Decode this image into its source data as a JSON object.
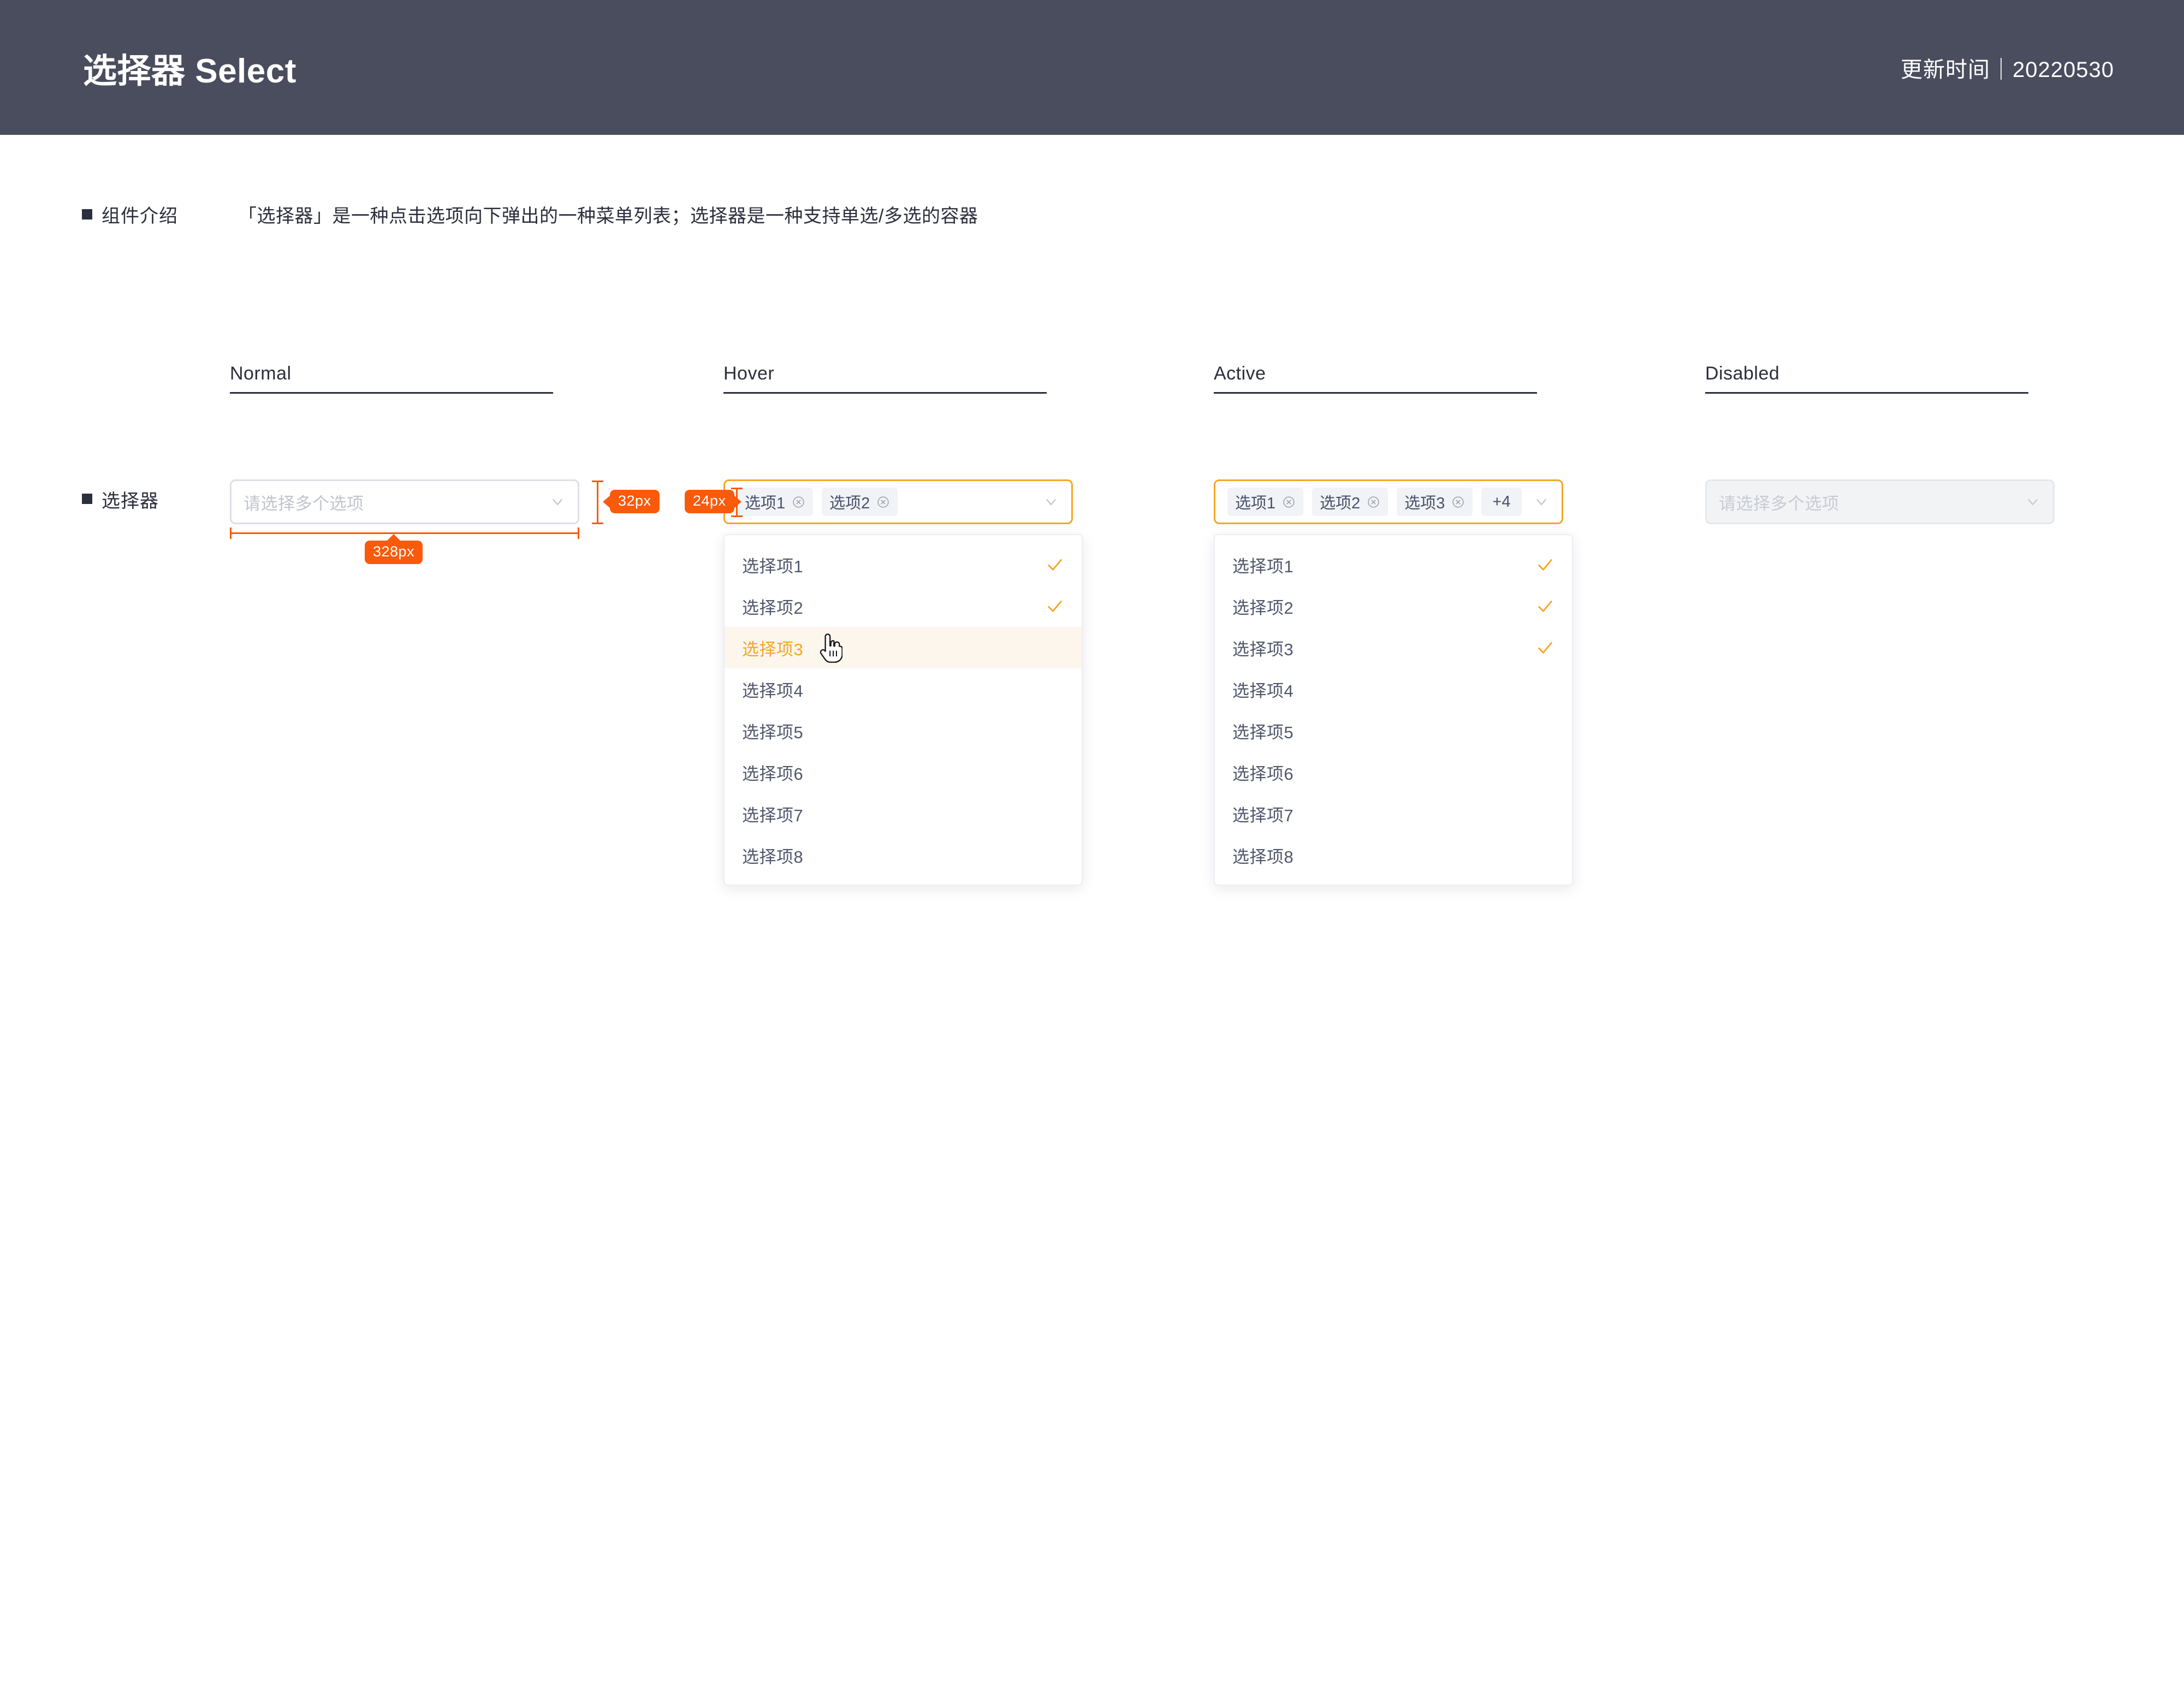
{
  "header": {
    "title": "选择器 Select",
    "meta": "更新时间｜20220530"
  },
  "intro": {
    "label": "组件介绍",
    "text": "「选择器」是一种点击选项向下弹出的一种菜单列表；选择器是一种支持单选/多选的容器"
  },
  "row": {
    "label": "选择器"
  },
  "columns": [
    {
      "label": "Normal"
    },
    {
      "label": "Hover"
    },
    {
      "label": "Active"
    },
    {
      "label": "Disabled"
    }
  ],
  "colors": {
    "header_bg": "#4A4D5E",
    "accent_orange": "#F5A623",
    "annotation_orange": "#FA5A0A",
    "border_default": "#DCDFE6",
    "tag_bg": "#F1F3F6",
    "disabled_bg": "#F2F3F5",
    "hover_row_bg": "#FDF6EC",
    "text_primary": "#2B2E3C",
    "text_placeholder": "#C0C4CC"
  },
  "normal": {
    "placeholder": "请选择多个选项",
    "chevron_icon": "chevron-down-icon"
  },
  "disabled": {
    "placeholder": "请选择多个选项",
    "chevron_icon": "chevron-down-icon"
  },
  "hover": {
    "tags": [
      {
        "label": "选项1",
        "close_icon": "circle-close-icon"
      },
      {
        "label": "选项2",
        "close_icon": "circle-close-icon"
      }
    ],
    "chevron_icon": "chevron-down-icon",
    "options": [
      {
        "label": "选择项1",
        "checked": true,
        "hovered": false
      },
      {
        "label": "选择项2",
        "checked": true,
        "hovered": false
      },
      {
        "label": "选择项3",
        "checked": false,
        "hovered": true
      },
      {
        "label": "选择项4",
        "checked": false,
        "hovered": false
      },
      {
        "label": "选择项5",
        "checked": false,
        "hovered": false
      },
      {
        "label": "选择项6",
        "checked": false,
        "hovered": false
      },
      {
        "label": "选择项7",
        "checked": false,
        "hovered": false
      },
      {
        "label": "选择项8",
        "checked": false,
        "hovered": false
      }
    ]
  },
  "active": {
    "tags": [
      {
        "label": "选项1",
        "close_icon": "circle-close-icon"
      },
      {
        "label": "选项2",
        "close_icon": "circle-close-icon"
      },
      {
        "label": "选项3",
        "close_icon": "circle-close-icon"
      },
      {
        "label": "+4",
        "close_icon": ""
      }
    ],
    "chevron_icon": "chevron-down-icon",
    "options": [
      {
        "label": "选择项1",
        "checked": true,
        "hovered": false
      },
      {
        "label": "选择项2",
        "checked": true,
        "hovered": false
      },
      {
        "label": "选择项3",
        "checked": true,
        "hovered": false
      },
      {
        "label": "选择项4",
        "checked": false,
        "hovered": false
      },
      {
        "label": "选择项5",
        "checked": false,
        "hovered": false
      },
      {
        "label": "选择项6",
        "checked": false,
        "hovered": false
      },
      {
        "label": "选择项7",
        "checked": false,
        "hovered": false
      },
      {
        "label": "选择项8",
        "checked": false,
        "hovered": false
      }
    ]
  },
  "annotations": {
    "height_32": "32px",
    "width_328": "328px",
    "inner_24": "24px"
  }
}
